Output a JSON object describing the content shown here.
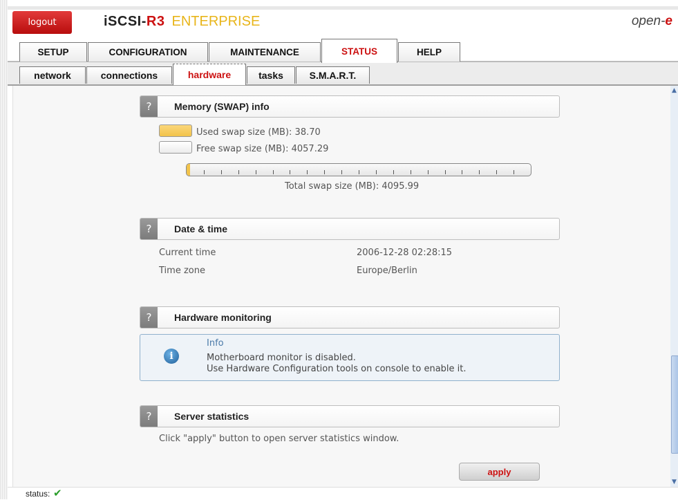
{
  "header": {
    "logout_label": "logout",
    "brand_main": "iSCSI-",
    "brand_r3": "R3",
    "brand_edition": "ENTERPRISE",
    "vendor_main": "open-",
    "vendor_e": "e"
  },
  "main_tabs": [
    {
      "label": "SETUP",
      "active": false
    },
    {
      "label": "CONFIGURATION",
      "active": false
    },
    {
      "label": "MAINTENANCE",
      "active": false
    },
    {
      "label": "STATUS",
      "active": true
    },
    {
      "label": "HELP",
      "active": false
    }
  ],
  "sub_tabs": [
    {
      "label": "network",
      "active": false
    },
    {
      "label": "connections",
      "active": false
    },
    {
      "label": "hardware",
      "active": true
    },
    {
      "label": "tasks",
      "active": false
    },
    {
      "label": "S.M.A.R.T.",
      "active": false
    }
  ],
  "memory": {
    "header": "Memory (SWAP) info",
    "used_label": "Used swap size (MB): 38.70",
    "free_label": "Free swap size (MB): 4057.29",
    "total_label": "Total swap size (MB): 4095.99",
    "used_fraction": 0.0094,
    "used_color": "#f2c34a",
    "free_color": "#ececec"
  },
  "datetime": {
    "header": "Date & time",
    "current_time_label": "Current time",
    "current_time_value": "2006-12-28 02:28:15",
    "timezone_label": "Time zone",
    "timezone_value": "Europe/Berlin"
  },
  "hardware_monitoring": {
    "header": "Hardware monitoring",
    "info_title": "Info",
    "info_line1": "Motherboard monitor is disabled.",
    "info_line2": "Use Hardware Configuration tools on console to enable it.",
    "info_icon": "info-icon"
  },
  "server_statistics": {
    "header": "Server statistics",
    "description": "Click \"apply\" button to open server statistics window.",
    "apply_label": "apply"
  },
  "help_glyph": "?",
  "statusbar": {
    "label": "status:",
    "icon": "check-icon",
    "color": "#2a9d2a"
  }
}
